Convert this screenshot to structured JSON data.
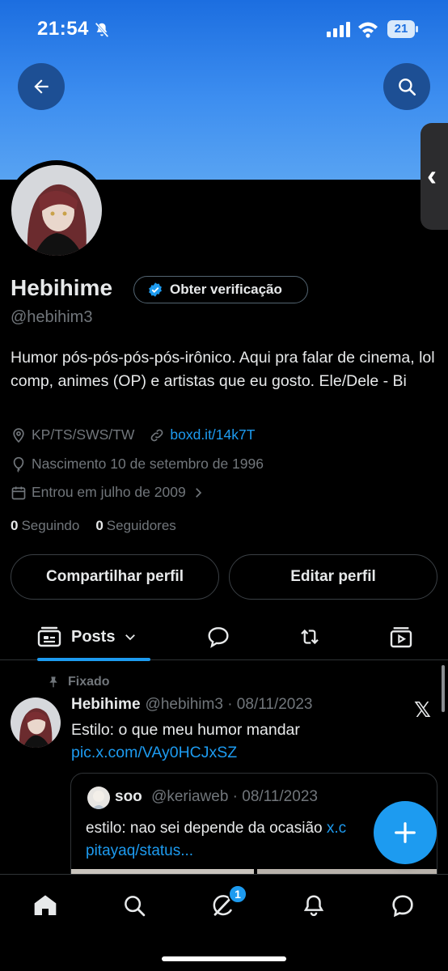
{
  "status_bar": {
    "time": "21:54",
    "battery": "21"
  },
  "profile": {
    "name": "Hebihime",
    "verify_label": "Obter verificação",
    "handle": "@hebihim3",
    "bio": "Humor pós-pós-pós-pós-irônico. Aqui pra falar de cinema, lol comp, animes (OP) e artistas que eu gosto. Ele/Dele - Bi",
    "location": "KP/TS/SWS/TW",
    "website": "boxd.it/14k7T",
    "birth": "Nascimento 10 de setembro de 1996",
    "joined": "Entrou em julho de 2009",
    "following_count": "0",
    "following_label": "Seguindo",
    "followers_count": "0",
    "followers_label": "Seguidores",
    "share_button": "Compartilhar perfil",
    "edit_button": "Editar perfil"
  },
  "tabs": {
    "posts_label": "Posts"
  },
  "pinned_tweet": {
    "pinned_label": "Fixado",
    "author_name": "Hebihime",
    "author_meta": "@hebihim3 · 08/11/2023",
    "text": "Estilo: o que meu humor mandar ",
    "link": "pic.x.com/VAy0HCJxSZ",
    "source_logo": "𝕏",
    "quote": {
      "author_name": "soo",
      "author_meta": "@keriaweb · 08/11/2023",
      "text": "estilo: nao sei depende da ocasião ",
      "link": "x.c",
      "link_cont": "pitayaq/status..."
    }
  },
  "bottom_nav": {
    "messages_badge": "1"
  },
  "colors": {
    "accent": "#1d9bf0",
    "background": "#000000",
    "muted": "#71767b"
  }
}
